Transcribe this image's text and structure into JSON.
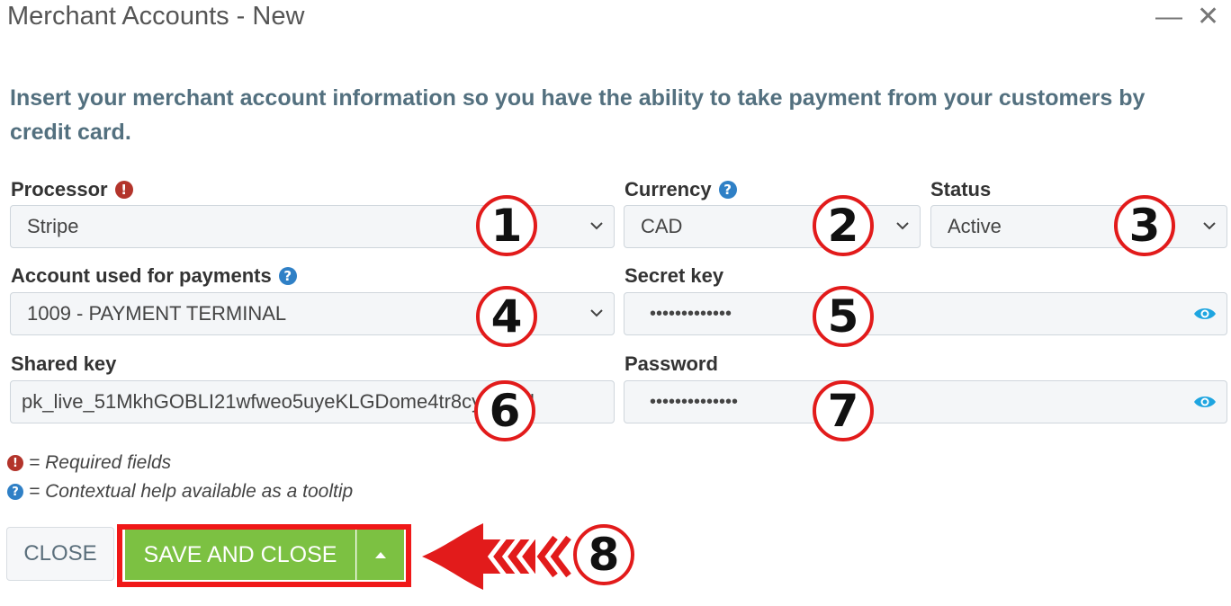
{
  "window": {
    "title": "Merchant Accounts - New",
    "minimize_label": "—",
    "close_label": "✕"
  },
  "intro": "Insert your merchant account information so you have the ability to take payment from your customers by credit card.",
  "fields": {
    "processor": {
      "label": "Processor",
      "value": "Stripe"
    },
    "currency": {
      "label": "Currency",
      "value": "CAD"
    },
    "status": {
      "label": "Status",
      "value": "Active"
    },
    "account": {
      "label": "Account used for payments",
      "value": "1009 - PAYMENT TERMINAL"
    },
    "secret_key": {
      "label": "Secret key",
      "value": "•••••••••••••"
    },
    "shared_key": {
      "label": "Shared key",
      "value": "pk_live_51MkhGOBLI21wfweo5uyeKLGDome4tr8cy40dfsl"
    },
    "password": {
      "label": "Password",
      "value": "••••••••••••••"
    }
  },
  "legend": {
    "required": "= Required fields",
    "help": "= Contextual help available as a tooltip"
  },
  "buttons": {
    "close": "CLOSE",
    "save_and_close": "SAVE AND CLOSE"
  },
  "callouts": [
    "1",
    "2",
    "3",
    "4",
    "5",
    "6",
    "7",
    "8"
  ],
  "colors": {
    "save_green": "#7cc142",
    "highlight_red": "#f01818",
    "help_blue": "#2f80c6",
    "required_red": "#b3342b",
    "eye_blue": "#1ea5e0"
  },
  "icons": {
    "required": "!",
    "help": "?"
  }
}
